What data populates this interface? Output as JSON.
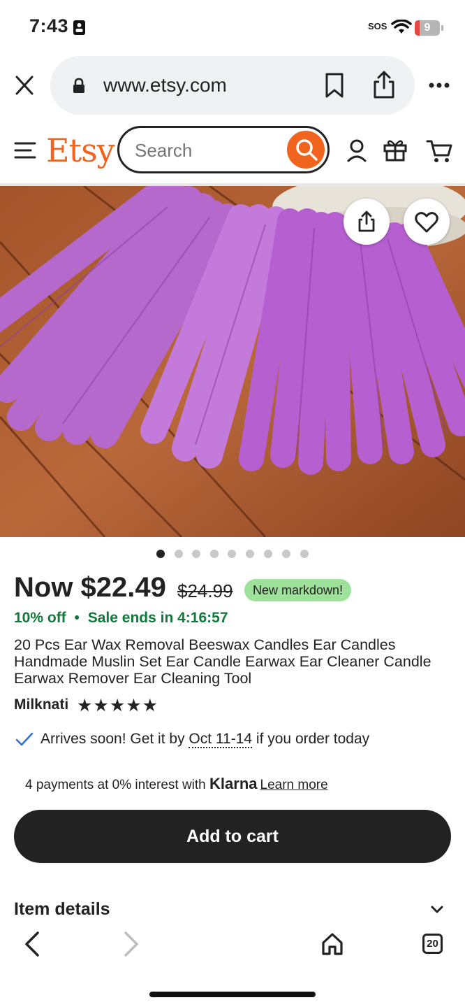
{
  "status_bar": {
    "time": "7:43",
    "sos": "SOS",
    "battery": "9"
  },
  "browser": {
    "url": "www.etsy.com",
    "tab_count": "20"
  },
  "header": {
    "logo": "Etsy",
    "search_placeholder": "Search"
  },
  "gallery": {
    "image_count": 9,
    "active_index": 0
  },
  "product": {
    "price": "Now $22.49",
    "original_price": "$24.99",
    "badge": "New markdown!",
    "discount": "10% off",
    "sale_ends": "Sale ends in 4:16:57",
    "title": "20 Pcs Ear Wax Removal Beeswax Candles Ear Candles Handmade Muslin Set Ear Candle Earwax Ear Cleaner Candle Earwax Remover Ear Cleaning Tool",
    "shop_name": "Milknati",
    "rating_stars": 5
  },
  "delivery": {
    "prefix": "Arrives soon! Get it by ",
    "dates": "Oct 11-14",
    "suffix": " if you order today"
  },
  "payments": {
    "text": "4 payments at 0% interest with ",
    "brand": "Klarna",
    "link": "Learn more"
  },
  "cart_button": "Add to cart",
  "item_details_label": "Item details",
  "colors": {
    "etsy_orange": "#f1641e",
    "sale_green": "#0f7a3a",
    "badge_green": "#9ee19a",
    "check_blue": "#2f6fd6"
  }
}
